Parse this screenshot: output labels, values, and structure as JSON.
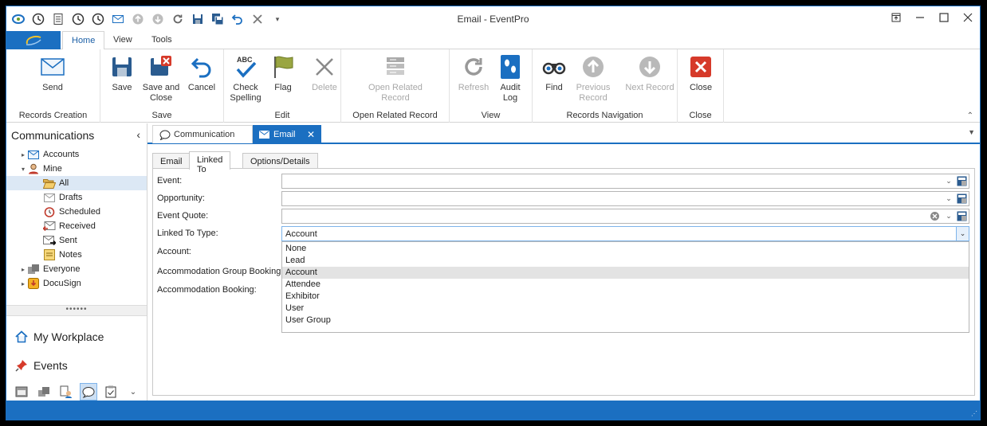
{
  "window": {
    "title": "Email - EventPro"
  },
  "ribbon_tabs": [
    "Home",
    "View",
    "Tools"
  ],
  "ribbon": {
    "records_creation": {
      "label": "Records Creation",
      "send": "Send"
    },
    "save": {
      "label": "Save",
      "save": "Save",
      "save_close_1": "Save and",
      "save_close_2": "Close",
      "cancel": "Cancel"
    },
    "edit": {
      "label": "Edit",
      "check_1": "Check",
      "check_2": "Spelling",
      "flag": "Flag",
      "delete": "Delete"
    },
    "open_related": {
      "label": "Open Related Record",
      "btn_1": "Open Related",
      "btn_2": "Record"
    },
    "view": {
      "label": "View",
      "refresh": "Refresh",
      "audit_1": "Audit",
      "audit_2": "Log"
    },
    "nav": {
      "label": "Records Navigation",
      "find": "Find",
      "prev_1": "Previous",
      "prev_2": "Record",
      "next": "Next Record"
    },
    "close": {
      "label": "Close",
      "close": "Close"
    }
  },
  "left_panel": {
    "title": "Communications",
    "tree": {
      "accounts": "Accounts",
      "mine": "Mine",
      "all": "All",
      "drafts": "Drafts",
      "scheduled": "Scheduled",
      "received": "Received",
      "sent": "Sent",
      "notes": "Notes",
      "everyone": "Everyone",
      "docusign": "DocuSign"
    },
    "splitter": "••••••",
    "my_workplace": "My Workplace",
    "events": "Events"
  },
  "doc_tabs": {
    "communication": "Communication",
    "email": "Email"
  },
  "sub_tabs": [
    "Email",
    "Linked To",
    "Options/Details"
  ],
  "form": {
    "event_label": "Event:",
    "opportunity_label": "Opportunity:",
    "event_quote_label": "Event Quote:",
    "linked_to_type_label": "Linked To Type:",
    "account_label": "Account:",
    "acc_group_label": "Accommodation Group Booking:",
    "acc_booking_label": "Accommodation Booking:",
    "linked_to_type_value": "Account"
  },
  "dropdown_options": [
    "None",
    "Lead",
    "Account",
    "Attendee",
    "Exhibitor",
    "User",
    "User Group"
  ],
  "colors": {
    "accent": "#1b6fc1",
    "selection": "#dce8f5"
  }
}
